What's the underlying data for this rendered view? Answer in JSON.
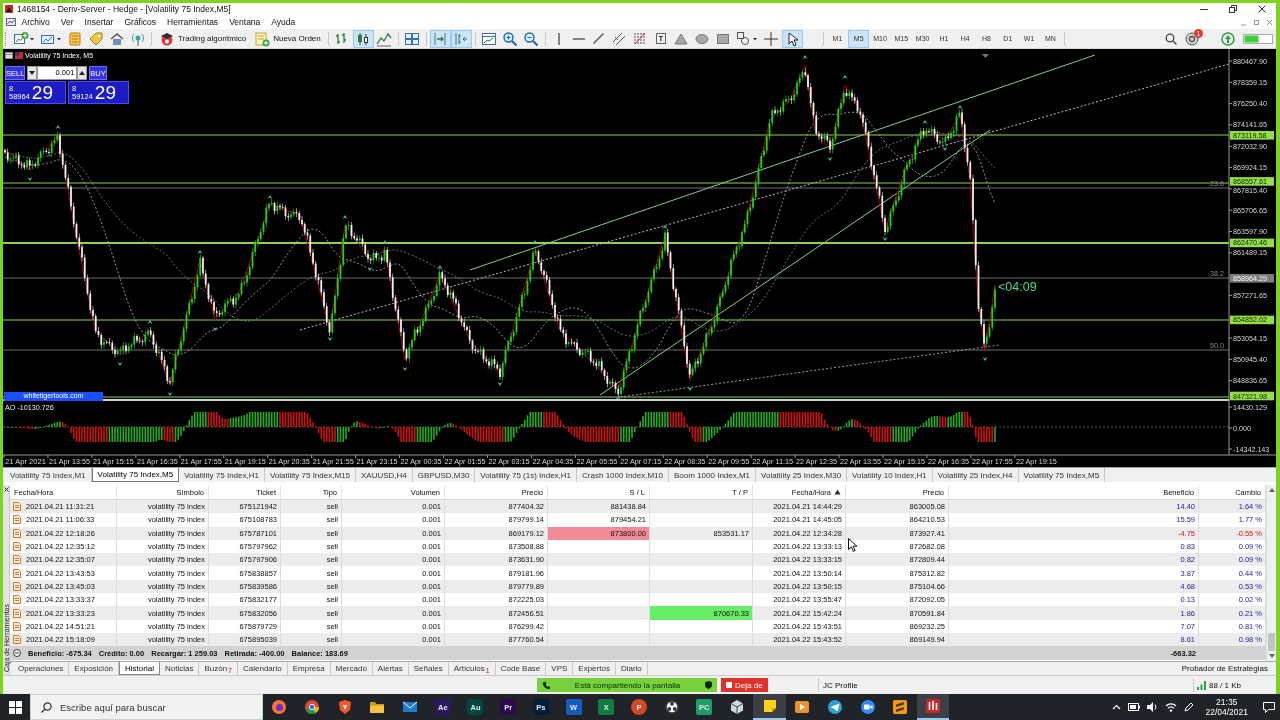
{
  "window": {
    "title": "1468154 - Deriv-Server - Hedge - [Volatility 75 Index,M5]"
  },
  "menu": [
    "Archivo",
    "Ver",
    "Insertar",
    "Gráficos",
    "Herramientas",
    "Ventana",
    "Ayuda"
  ],
  "toolbar": {
    "groups": [
      [
        {
          "kind": "newchart",
          "selected": false
        },
        {
          "kind": "profiles",
          "selected": false
        },
        {
          "kind": "coins",
          "selected": false
        },
        {
          "kind": "tag",
          "selected": false
        },
        {
          "kind": "house",
          "selected": false
        },
        {
          "kind": "antenna",
          "selected": false
        }
      ],
      [
        {
          "kind": "algo",
          "label": "Trading algorítmico",
          "selected": false
        },
        {
          "kind": "order",
          "label": "Nueva Orden",
          "selected": false
        }
      ],
      [
        {
          "kind": "bars",
          "selected": false
        },
        {
          "kind": "candles",
          "selected": true
        },
        {
          "kind": "line",
          "selected": false
        }
      ],
      [
        {
          "kind": "tile",
          "selected": false
        }
      ],
      [
        {
          "kind": "autoscroll",
          "selected": true
        },
        {
          "kind": "shift",
          "selected": true
        }
      ],
      [
        {
          "kind": "template",
          "selected": false
        },
        {
          "kind": "zoomin",
          "selected": false
        },
        {
          "kind": "zoomout",
          "selected": false
        }
      ],
      [
        {
          "kind": "vline",
          "selected": false
        },
        {
          "kind": "hline",
          "selected": false
        },
        {
          "kind": "trend",
          "selected": false
        },
        {
          "kind": "channel",
          "selected": false
        },
        {
          "kind": "fibo",
          "selected": false
        },
        {
          "kind": "text",
          "label": "T",
          "selected": false
        },
        {
          "kind": "triangle",
          "selected": false
        },
        {
          "kind": "ellipse",
          "selected": false
        },
        {
          "kind": "rectangle",
          "selected": false
        },
        {
          "kind": "shapes",
          "selected": false
        },
        {
          "kind": "crosshair",
          "selected": false
        },
        {
          "kind": "cursor",
          "selected": true
        }
      ]
    ],
    "timeframes": [
      {
        "label": "M1",
        "selected": false
      },
      {
        "label": "M5",
        "selected": true
      },
      {
        "label": "M10",
        "selected": false
      },
      {
        "label": "M15",
        "selected": false
      },
      {
        "label": "M30",
        "selected": false
      },
      {
        "label": "H1",
        "selected": false
      },
      {
        "label": "H4",
        "selected": false
      },
      {
        "label": "H8",
        "selected": false
      },
      {
        "label": "D1",
        "selected": false
      },
      {
        "label": "W1",
        "selected": false
      },
      {
        "label": "MN",
        "selected": false
      }
    ],
    "notification_badge": "1"
  },
  "chart": {
    "title": "Volatility 75 Index, M5",
    "one_click": {
      "sell": "SELL",
      "buy": "BUY",
      "volume": "0.001",
      "bid": {
        "lead": "8",
        "main": "58964",
        "pips": "29"
      },
      "ask": {
        "lead": "8",
        "main": "59124",
        "pips": "29"
      }
    },
    "price_labels": [
      {
        "text": "880467.90",
        "kind": "tick"
      },
      {
        "text": "878359.15",
        "kind": "tick"
      },
      {
        "text": "876250.40",
        "kind": "tick"
      },
      {
        "text": "874141.65",
        "kind": "tick"
      },
      {
        "text": "873119.58",
        "kind": "level"
      },
      {
        "text": "872032.90",
        "kind": "tick"
      },
      {
        "text": "869924.15",
        "kind": "tick"
      },
      {
        "text": "868557.61",
        "kind": "level"
      },
      {
        "text": "867815.40",
        "kind": "tick"
      },
      {
        "text": "865706.65",
        "kind": "tick"
      },
      {
        "text": "863597.90",
        "kind": "tick"
      },
      {
        "text": "862470.46",
        "kind": "level"
      },
      {
        "text": "861489.15",
        "kind": "tick"
      },
      {
        "text": "858964.29",
        "kind": "bid"
      },
      {
        "text": "857271.65",
        "kind": "tick"
      },
      {
        "text": "854852.02",
        "kind": "level"
      },
      {
        "text": "853054.15",
        "kind": "tick"
      },
      {
        "text": "850945.40",
        "kind": "tick"
      },
      {
        "text": "848836.65",
        "kind": "tick"
      },
      {
        "text": "847321.98",
        "kind": "level"
      }
    ],
    "fib_labels": [
      "23.6",
      "38.2",
      "50.0"
    ],
    "timer": "<04:09",
    "tag": "whitetigertools.com",
    "indicator": {
      "title": "AO -10130.726",
      "labels": [
        "14430.129",
        "0.000",
        "-14342.143"
      ]
    },
    "time_labels": [
      "21 Apr 2021",
      "21 Apr 13:55",
      "21 Apr 15:15",
      "21 Apr 16:35",
      "21 Apr 17:55",
      "21 Apr 19:15",
      "21 Apr 20:35",
      "21 Apr 21:55",
      "21 Apr 23:15",
      "22 Apr 00:35",
      "22 Apr 01:55",
      "22 Apr 03:15",
      "22 Apr 04:35",
      "22 Apr 05:55",
      "22 Apr 07:15",
      "22 Apr 08:35",
      "22 Apr 09:55",
      "22 Apr 11:15",
      "22 Apr 12:35",
      "22 Apr 13:55",
      "22 Apr 15:15",
      "22 Apr 16:35",
      "22 Apr 17:55",
      "22 Apr 19:15"
    ]
  },
  "chart_tabs": [
    {
      "label": "Volatility 75 Index,M1",
      "selected": false
    },
    {
      "label": "Volatility 75 Index,M5",
      "selected": true
    },
    {
      "label": "Volatility 75 Index,H1",
      "selected": false
    },
    {
      "label": "Volatility 75 Index,M15",
      "selected": false
    },
    {
      "label": "XAUUSD,H4",
      "selected": false
    },
    {
      "label": "GBPUSD,M30",
      "selected": false
    },
    {
      "label": "Volatility 75 (1s) Index,H1",
      "selected": false
    },
    {
      "label": "Crash 1000 Index,M10",
      "selected": false
    },
    {
      "label": "Boom 1000 Index,M1",
      "selected": false
    },
    {
      "label": "Volatility 25 Index,M30",
      "selected": false
    },
    {
      "label": "Volatility 10 Index,H1",
      "selected": false
    },
    {
      "label": "Volatility 25 Index,H4",
      "selected": false
    },
    {
      "label": "Volatility 75 Index,M5",
      "selected": false
    }
  ],
  "toolbox": {
    "title": "Caja de Herramientas",
    "columns": [
      {
        "label": "Fecha/Hora",
        "sorted": false
      },
      {
        "label": "Símbolo",
        "sorted": false
      },
      {
        "label": "Ticket",
        "sorted": false
      },
      {
        "label": "Tipo",
        "sorted": false
      },
      {
        "label": "Volumen",
        "sorted": false
      },
      {
        "label": "Precio",
        "sorted": false
      },
      {
        "label": "S / L",
        "sorted": false
      },
      {
        "label": "T / P",
        "sorted": false
      },
      {
        "label": "Fecha/Hora",
        "sorted": true
      },
      {
        "label": "Precio",
        "sorted": false
      },
      {
        "label": "Beneficio",
        "sorted": false
      },
      {
        "label": "Cambio",
        "sorted": false
      }
    ],
    "rows": [
      {
        "open_time": "2021.04.21 11:31:21",
        "symbol": "volatility 75 index",
        "ticket": "675121942",
        "type": "sell",
        "volume": "0.001",
        "open_price": "877404.32",
        "sl": "881438.84",
        "sl_hit": false,
        "tp_hit": false,
        "close_time": "2021.04.21 14:44:29",
        "close_price": "863005.08",
        "profit": "14.40",
        "change": "1.64 %",
        "loss": false
      },
      {
        "open_time": "2021.04.21 11:06:33",
        "symbol": "volatility 75 index",
        "ticket": "675108783",
        "type": "sell",
        "volume": "0.001",
        "open_price": "879799.14",
        "sl": "879454.21",
        "sl_hit": false,
        "tp_hit": false,
        "close_time": "2021.04.21 14:45:05",
        "close_price": "864210.53",
        "profit": "15.59",
        "change": "1.77 %",
        "loss": false
      },
      {
        "open_time": "2021.04.22 12:18:26",
        "symbol": "volatility 75 index",
        "ticket": "675787101",
        "type": "sell",
        "volume": "0.001",
        "open_price": "869179.12",
        "sl": "873800.00",
        "sl_hit": true,
        "tp": "853531.17",
        "tp_hit": false,
        "close_time": "2021.04.22 12:34:28",
        "close_price": "873927.41",
        "profit": "-4.75",
        "change": "-0.55 %",
        "loss": true
      },
      {
        "open_time": "2021.04.22 12:35:12",
        "symbol": "volatility 75 index",
        "ticket": "675797962",
        "type": "sell",
        "volume": "0.001",
        "open_price": "873508.88",
        "sl_hit": false,
        "tp_hit": false,
        "close_time": "2021.04.22 13:33:13",
        "close_price": "872682.08",
        "profit": "0.83",
        "change": "0.09 %",
        "loss": false
      },
      {
        "open_time": "2021.04.22 12:35:07",
        "symbol": "volatility 75 index",
        "ticket": "675797906",
        "type": "sell",
        "volume": "0.001",
        "open_price": "873631.90",
        "sl_hit": false,
        "tp_hit": false,
        "close_time": "2021.04.22 13:33:15",
        "close_price": "872809.44",
        "profit": "0.82",
        "change": "0.09 %",
        "loss": false
      },
      {
        "open_time": "2021.04.22 13:43:53",
        "symbol": "volatility 75 index",
        "ticket": "675838857",
        "type": "sell",
        "volume": "0.001",
        "open_price": "879181.96",
        "sl_hit": false,
        "tp_hit": false,
        "close_time": "2021.04.22 13:50:14",
        "close_price": "875312.82",
        "profit": "3.87",
        "change": "0.44 %",
        "loss": false
      },
      {
        "open_time": "2021.04.22 13:45:03",
        "symbol": "volatility 75 index",
        "ticket": "675839586",
        "type": "sell",
        "volume": "0.001",
        "open_price": "879779.89",
        "sl_hit": false,
        "tp_hit": false,
        "close_time": "2021.04.22 13:50:15",
        "close_price": "875104.66",
        "profit": "4.68",
        "change": "0.53 %",
        "loss": false
      },
      {
        "open_time": "2021.04.22 13:33:37",
        "symbol": "volatility 75 index",
        "ticket": "675832177",
        "type": "sell",
        "volume": "0.001",
        "open_price": "872225.03",
        "sl_hit": false,
        "tp_hit": false,
        "close_time": "2021.04.22 13:55:47",
        "close_price": "872092.05",
        "profit": "0.13",
        "change": "0.02 %",
        "loss": false
      },
      {
        "open_time": "2021.04.22 13:33:23",
        "symbol": "volatility 75 index",
        "ticket": "675832056",
        "type": "sell",
        "volume": "0.001",
        "open_price": "872456.51",
        "sl_hit": false,
        "tp": "870670.33",
        "tp_hit": true,
        "close_time": "2021.04.22 15:42:24",
        "close_price": "870591.84",
        "profit": "1.86",
        "change": "0.21 %",
        "loss": false
      },
      {
        "open_time": "2021.04.22 14:51:21",
        "symbol": "volatility 75 index",
        "ticket": "675879729",
        "type": "sell",
        "volume": "0.001",
        "open_price": "876299.42",
        "sl_hit": false,
        "tp_hit": false,
        "close_time": "2021.04.22 15:43:51",
        "close_price": "869232.25",
        "profit": "7.07",
        "change": "0.81 %",
        "loss": false
      },
      {
        "open_time": "2021.04.22 15:18:09",
        "symbol": "volatility 75 index",
        "ticket": "675895039",
        "type": "sell",
        "volume": "0.001",
        "open_price": "877760.54",
        "sl_hit": false,
        "tp_hit": false,
        "close_time": "2021.04.22 15:43:52",
        "close_price": "869149.94",
        "profit": "8.61",
        "change": "0.98 %",
        "loss": false
      }
    ],
    "summary": [
      "Beneficio: -675.34",
      "Crédito: 0.00",
      "Recargar: 1 259.03",
      "Retirada: -400.00",
      "Balance: 183.69"
    ],
    "total": "-663.32",
    "tabs": [
      {
        "label": "Operaciones",
        "selected": false
      },
      {
        "label": "Exposición",
        "selected": false
      },
      {
        "label": "Historial",
        "selected": true
      },
      {
        "label": "Noticias",
        "selected": false
      },
      {
        "label": "Buzón",
        "badge": "7",
        "selected": false
      },
      {
        "label": "Calendario",
        "selected": false
      },
      {
        "label": "Empresa",
        "selected": false
      },
      {
        "label": "Mercado",
        "selected": false
      },
      {
        "label": "Alertas",
        "selected": false
      },
      {
        "label": "Señales",
        "selected": false
      },
      {
        "label": "Artículos",
        "badge": "1",
        "selected": false
      },
      {
        "label": "Code Base",
        "selected": false
      },
      {
        "label": "VPS",
        "selected": false
      },
      {
        "label": "Expertos",
        "selected": false
      },
      {
        "label": "Diario",
        "selected": false
      }
    ],
    "tester": "Probador de Estrategias"
  },
  "status_bar": {
    "profile": "JC Profile",
    "traffic": "88 / 1 Kb"
  },
  "sharing_bar": {
    "message": "Está compartiendo la pantalla",
    "stop": "Deja de"
  },
  "taskbar": {
    "search": {
      "placeholder": "Escribe aquí para buscar"
    },
    "apps": [
      {
        "kind": "orb",
        "color": "#ff7139",
        "active": false
      },
      {
        "kind": "wheel",
        "color": "#db4437",
        "active": false
      },
      {
        "kind": "shield",
        "color": "#fb542b",
        "active": false
      },
      {
        "kind": "folder",
        "color": "#f5c242",
        "active": false
      },
      {
        "kind": "envelope",
        "color": "#1f7ad6",
        "active": false
      },
      {
        "kind": "tile",
        "label": "Ae",
        "color": "#2b1a5e",
        "active": false
      },
      {
        "kind": "tile",
        "label": "Au",
        "color": "#00473f",
        "active": false
      },
      {
        "kind": "tile",
        "label": "Pr",
        "color": "#2a0a4a",
        "active": false
      },
      {
        "kind": "tile",
        "label": "Ps",
        "color": "#001e36",
        "active": false
      },
      {
        "kind": "tile",
        "label": "W",
        "color": "#185abd",
        "active": false
      },
      {
        "kind": "tile",
        "label": "X",
        "color": "#107c41",
        "active": false
      },
      {
        "kind": "disc",
        "label": "P",
        "color": "#d24726",
        "active": false
      },
      {
        "kind": "ring",
        "color": "#3a3a3a",
        "active": false
      },
      {
        "kind": "tile",
        "label": "PC",
        "color": "#1e9e66",
        "active": false
      },
      {
        "kind": "cube",
        "color": "#cfd8dc",
        "active": false
      },
      {
        "kind": "note",
        "color": "#fcd116",
        "active": true
      },
      {
        "kind": "play",
        "color": "#e8912d",
        "active": false
      },
      {
        "kind": "plane",
        "color": "#2aa1da",
        "active": false
      },
      {
        "kind": "camera",
        "color": "#2d8cff",
        "active": false
      },
      {
        "kind": "stripes",
        "color": "#ff9800",
        "active": false
      },
      {
        "kind": "bars",
        "color": "#c62828",
        "active": true
      }
    ],
    "clock": {
      "time": "21:35",
      "date": "22/04/2021"
    }
  }
}
